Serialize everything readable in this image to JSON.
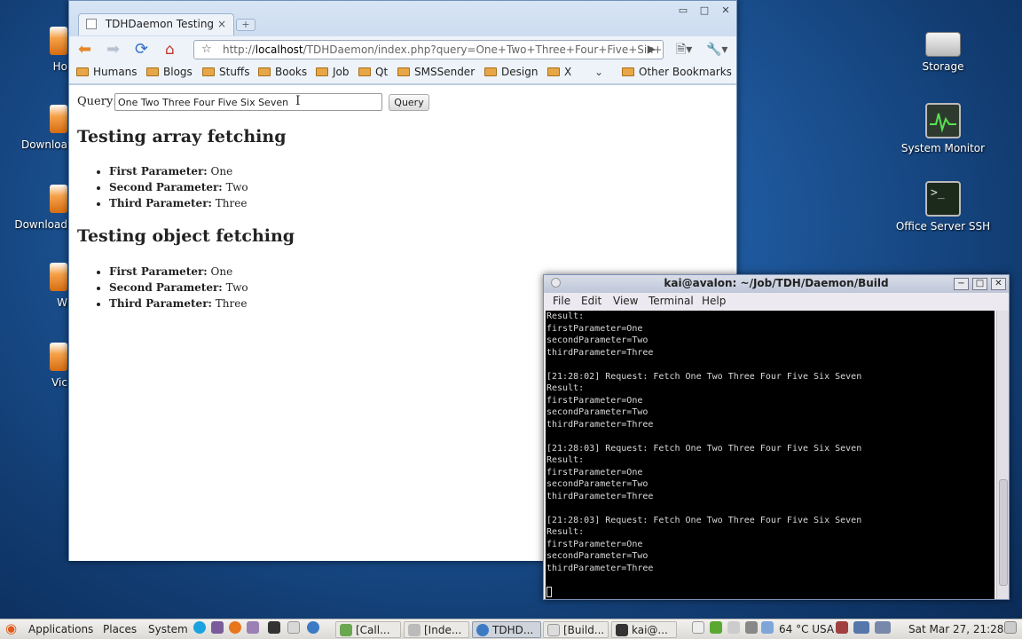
{
  "desktop": {
    "right_icons": [
      {
        "label": "Storage",
        "icon": "storage-drive-icon"
      },
      {
        "label": "System Monitor",
        "icon": "system-monitor-icon"
      },
      {
        "label": "Office Server SSH",
        "icon": "terminal-icon"
      }
    ],
    "left_icons": [
      {
        "label": "Ho"
      },
      {
        "label": "Downloa"
      },
      {
        "label": "Download"
      },
      {
        "label": "W"
      },
      {
        "label": "Vic"
      }
    ]
  },
  "browser": {
    "tab_title": "TDHDaemon Testing",
    "tab_close": "×",
    "new_tab": "+",
    "window_buttons": [
      "▭",
      "□",
      "✕"
    ],
    "url_prefix": "http://",
    "url_host": "localhost",
    "url_rest": "/TDHDaemon/index.php?query=One+Two+Three+Four+Five+Six+",
    "bookmarks": [
      "Humans",
      "Blogs",
      "Stuffs",
      "Books",
      "Job",
      "Qt",
      "SMSSender",
      "Design",
      "X"
    ],
    "other_bookmarks": "Other Bookmarks",
    "page": {
      "query_label": "Query:",
      "query_value": "One Two Three Four Five Six Seven",
      "query_button": "Query",
      "section1_title": "Testing array fetching",
      "section1_items": [
        {
          "key": "First Parameter:",
          "value": "One"
        },
        {
          "key": "Second Parameter:",
          "value": "Two"
        },
        {
          "key": "Third Parameter:",
          "value": "Three"
        }
      ],
      "section2_title": "Testing object fetching",
      "section2_items": [
        {
          "key": "First Parameter:",
          "value": "One"
        },
        {
          "key": "Second Parameter:",
          "value": "Two"
        },
        {
          "key": "Third Parameter:",
          "value": "Three"
        }
      ]
    }
  },
  "terminal": {
    "title": "kai@avalon: ~/Job/TDH/Daemon/Build",
    "menu": [
      "File",
      "Edit",
      "View",
      "Terminal",
      "Help"
    ],
    "lines": [
      "Result:",
      "firstParameter=One",
      "secondParameter=Two",
      "thirdParameter=Three",
      "",
      "[21:28:02] Request: Fetch One Two Three Four Five Six Seven",
      "Result:",
      "firstParameter=One",
      "secondParameter=Two",
      "thirdParameter=Three",
      "",
      "[21:28:03] Request: Fetch One Two Three Four Five Six Seven",
      "Result:",
      "firstParameter=One",
      "secondParameter=Two",
      "thirdParameter=Three",
      "",
      "[21:28:03] Request: Fetch One Two Three Four Five Six Seven",
      "Result:",
      "firstParameter=One",
      "secondParameter=Two",
      "thirdParameter=Three"
    ]
  },
  "taskbar": {
    "applications": "Applications",
    "places": "Places",
    "system": "System",
    "tasks": [
      "[Call...",
      "[Inde...",
      "TDHD...",
      "[Build...",
      "kai@..."
    ],
    "weather": "64 °C USA",
    "clock": "Sat Mar 27, 21:28"
  }
}
